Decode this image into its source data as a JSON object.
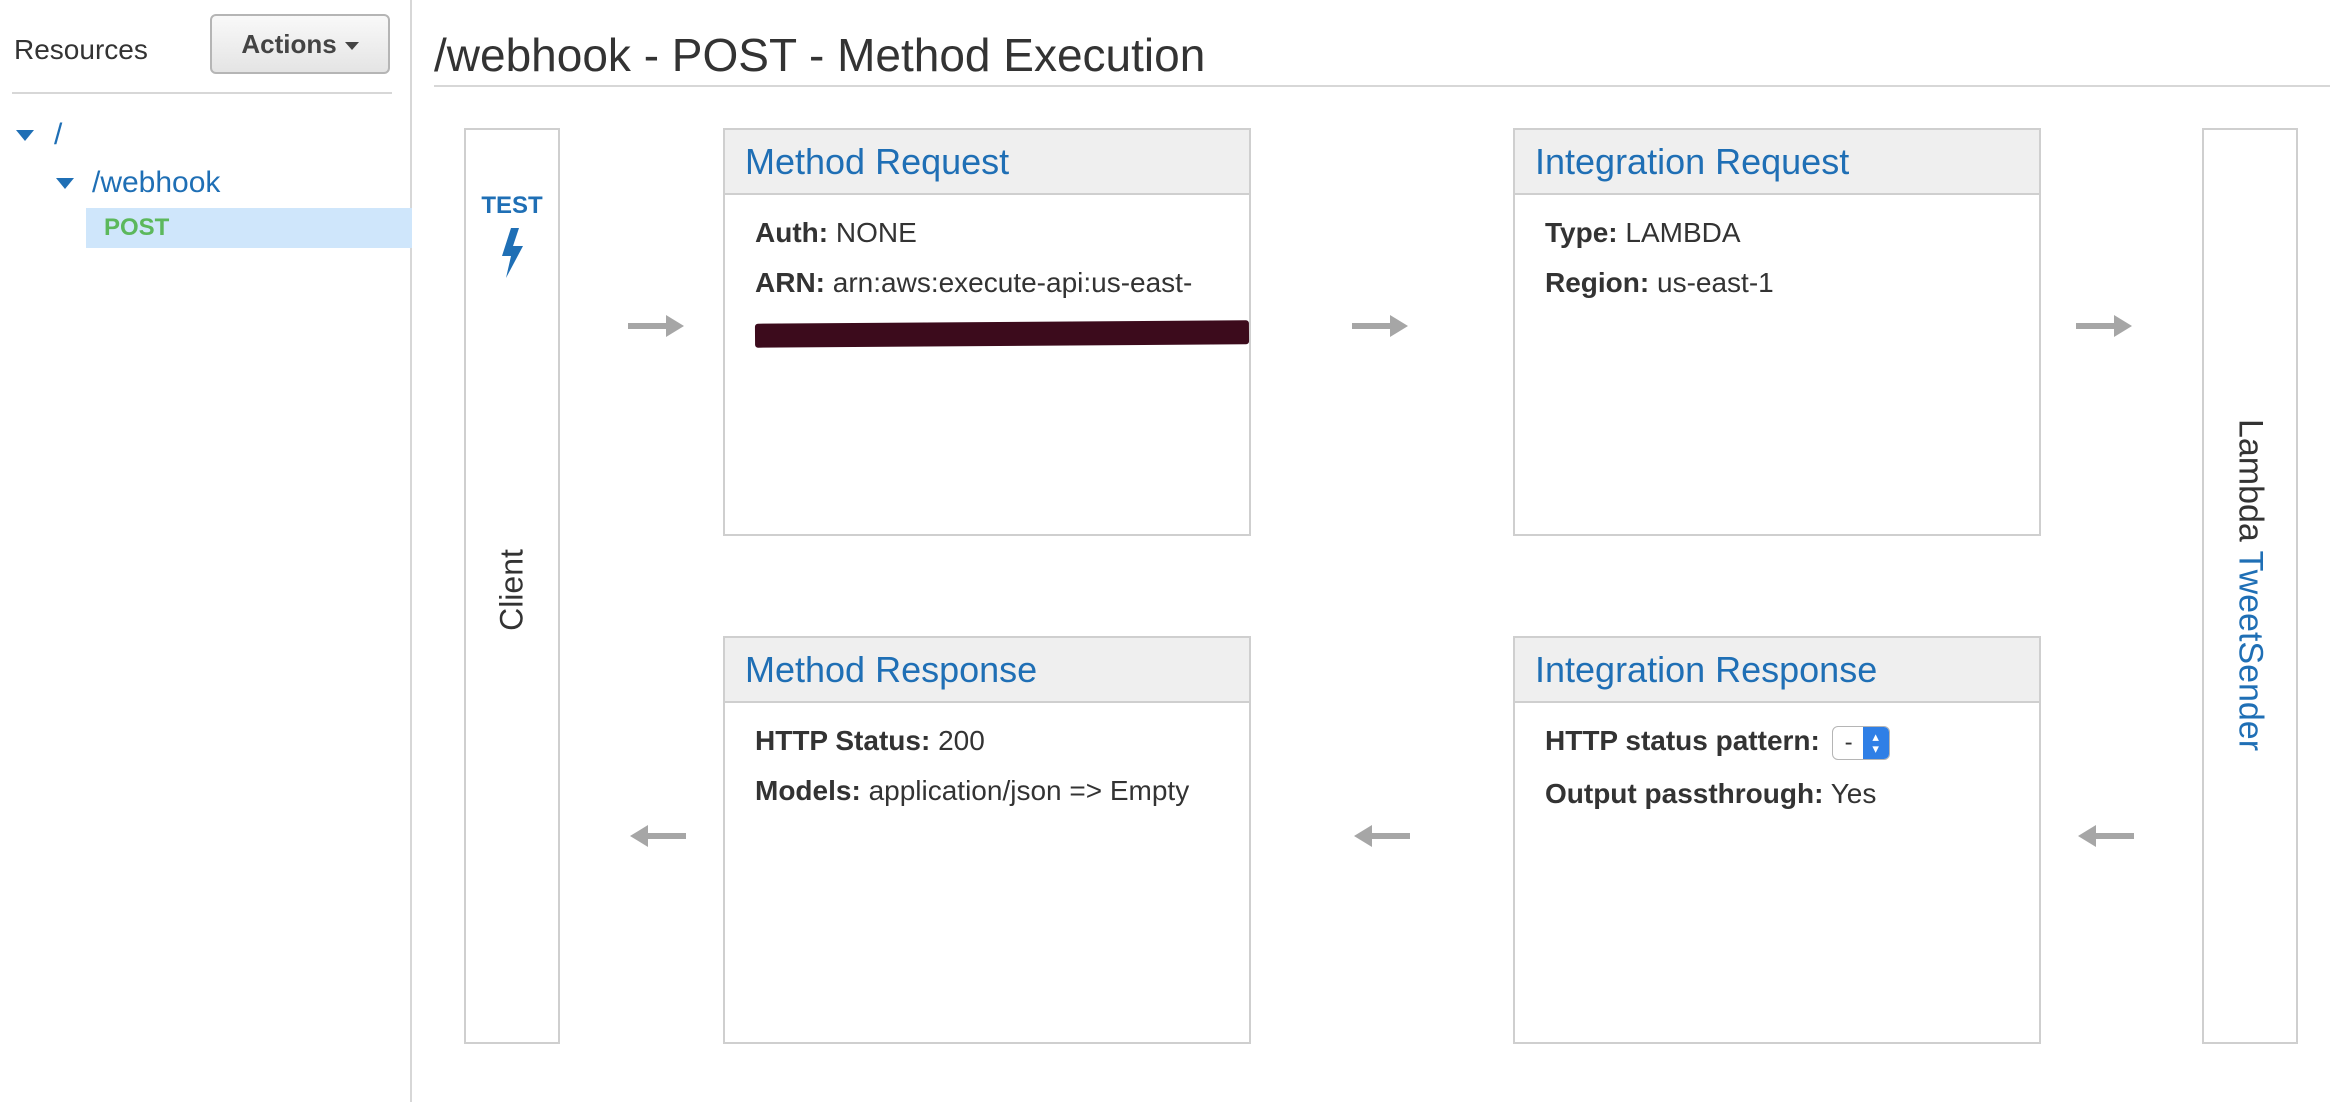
{
  "sidebar": {
    "title": "Resources",
    "actions_label": "Actions",
    "tree": {
      "root_label": "/",
      "resource_label": "/webhook",
      "method_label": "POST"
    }
  },
  "main": {
    "title": "/webhook - POST - Method Execution",
    "client": {
      "test_label": "TEST",
      "label": "Client"
    },
    "lambda": {
      "prefix": "Lambda",
      "function_name": "TweetSender"
    },
    "method_request": {
      "title": "Method Request",
      "auth_label": "Auth:",
      "auth_value": "NONE",
      "arn_label": "ARN:",
      "arn_value": "arn:aws:execute-api:us-east-"
    },
    "integration_request": {
      "title": "Integration Request",
      "type_label": "Type:",
      "type_value": "LAMBDA",
      "region_label": "Region:",
      "region_value": "us-east-1"
    },
    "method_response": {
      "title": "Method Response",
      "status_label": "HTTP Status:",
      "status_value": "200",
      "models_label": "Models:",
      "models_value": "application/json => Empty"
    },
    "integration_response": {
      "title": "Integration Response",
      "pattern_label": "HTTP status pattern:",
      "pattern_value": "-",
      "passthrough_label": "Output passthrough:",
      "passthrough_value": "Yes"
    }
  },
  "colors": {
    "link": "#1f6fb5",
    "method_green": "#5cb85c",
    "selected_row": "#cfe6fb",
    "card_header": "#efefef",
    "arrow": "#a6a6a6",
    "redaction": "#3c0b1c"
  }
}
